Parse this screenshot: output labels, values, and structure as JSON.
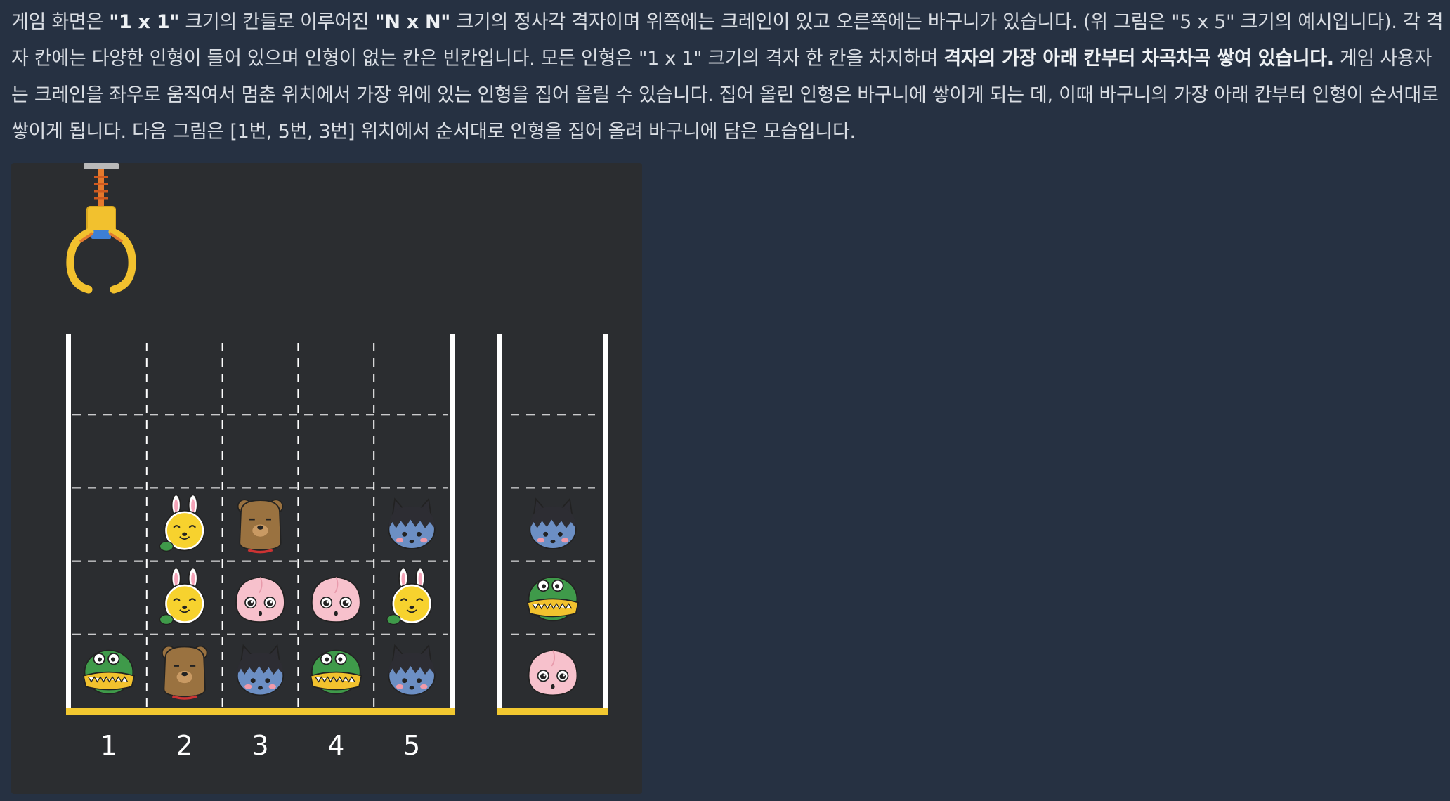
{
  "description": {
    "paragraph": [
      "게임 화면은 ",
      "\"1 x 1\"",
      " 크기의 칸들로 이루어진 ",
      "\"N x N\"",
      " 크기의 정사각 격자이며 위쪽에는 크레인이 있고 오른쪽에는 바구니가 있습니다. (위 그림은 \"5 x 5\" 크기의 예시입니다). 각 격자 칸에는 다양한 인형이 들어 있으며 인형이 없는 칸은 빈칸입니다. 모든 인형은 \"1 x 1\" 크기의 격자 한 칸을 차지하며 ",
      "격자의 가장 아래 칸부터 차곡차곡 쌓여 있습니다.",
      " 게임 사용자는 크레인을 좌우로 움직여서 멈춘 위치에서 가장 위에 있는 인형을 집어 올릴 수 있습니다. 집어 올린 인형은 바구니에 쌓이게 되는 데, 이때 바구니의 가장 아래 칸부터 인형이 순서대로 쌓이게 됩니다. 다음 그림은 [1번, 5번, 3번] 위치에서 순서대로 인형을 집어 올려 바구니에 담은 모습입니다."
    ]
  },
  "figure": {
    "column_labels": [
      "1",
      "2",
      "3",
      "4",
      "5"
    ],
    "board": [
      [
        "",
        "",
        "",
        "",
        ""
      ],
      [
        "",
        "",
        "",
        "",
        ""
      ],
      [
        "",
        "rabbit",
        "bear",
        "",
        "neo"
      ],
      [
        "",
        "rabbit",
        "peach",
        "peach",
        "rabbit"
      ],
      [
        "croc",
        "bear",
        "neo",
        "croc",
        "neo"
      ]
    ],
    "basket": [
      "peach",
      "croc",
      "neo"
    ],
    "colors": {
      "panel": "#2b2d30",
      "wall": "#ffffff",
      "floor": "#f2c830",
      "crane": "#f2c12e"
    }
  }
}
